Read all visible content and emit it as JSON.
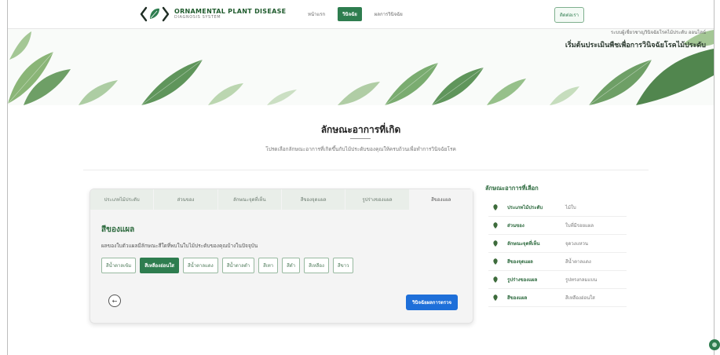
{
  "header": {
    "logo_title": "ORNAMENTAL PLANT DISEASE",
    "logo_subtitle": "DIAGNOSIS SYSTEM",
    "nav": [
      "หน้าแรก",
      "วินิจฉัย",
      "ผลการวินิจฉัย"
    ],
    "nav_active_index": 1,
    "right_button": "ติดต่อเรา"
  },
  "hero": {
    "line1": "ระบบผู้เชี่ยวชาญวินิจฉัยโรคไม้ประดับ ออนไลน์",
    "line2": "เริ่มต้นประเมินพืชเพื่อการวินิจฉัยโรคไม้ประดับ"
  },
  "section": {
    "title": "ลักษณะอาการที่เกิด",
    "subtitle": "โปรดเลือกลักษณะอาการที่เกิดขึ้นกับไม้ประดับของคุณให้ครบถ้วนเพื่อทำการวินิจฉัยโรค"
  },
  "tabs": [
    "ประเภทไม้ประดับ",
    "ส่วนของ",
    "ลักษณะจุดที่เห็น",
    "สีของจุดแผล",
    "รูปร่างของแผล",
    "สีของแผล"
  ],
  "active_tab_index": 5,
  "question": {
    "title": "สีของแผล",
    "description": "ผลของใบตัวแผลมีลักษณะสีใดที่พบในใบไม้ประดับของคุณบ้างในปัจจุบัน",
    "options": [
      "สีน้ำตาลเข้ม",
      "สีเหลืองอ่อนใส",
      "สีน้ำตาลแดง",
      "สีน้ำตาลดำ",
      "สีเทา",
      "สีดำ",
      "สีเหลือง",
      "สีขาว"
    ],
    "selected_index": 1
  },
  "buttons": {
    "back_icon": "←",
    "submit": "วินิจฉัยผลการตรวจ"
  },
  "summary": {
    "heading": "ลักษณะอาการที่เลือก",
    "rows": [
      {
        "label": "ประเภทไม้ประดับ",
        "value": "ไม้ใบ"
      },
      {
        "label": "ส่วนของ",
        "value": "ใบที่มีรอยแผล"
      },
      {
        "label": "ลักษณะจุดที่เห็น",
        "value": "จุดวงแหวน"
      },
      {
        "label": "สีของจุดแผล",
        "value": "สีน้ำตาลแดง"
      },
      {
        "label": "รูปร่างของแผล",
        "value": "รูปทรงกลมแบน"
      },
      {
        "label": "สีของแผล",
        "value": "สีเหลืองอ่อนใส"
      }
    ]
  },
  "colors": {
    "accent": "#2e7d4f",
    "submit": "#1e6fd9"
  }
}
